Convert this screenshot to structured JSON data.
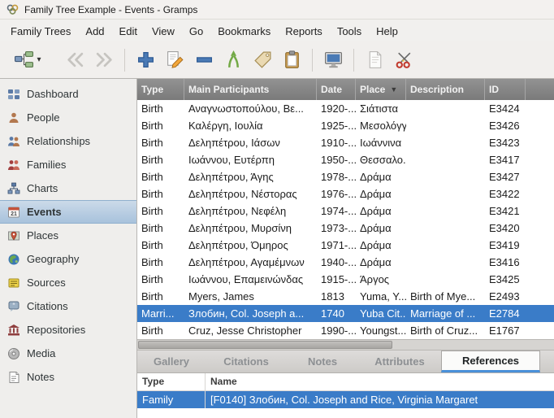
{
  "window": {
    "title": "Family Tree Example - Events - Gramps"
  },
  "menu": {
    "items": [
      "Family Trees",
      "Add",
      "Edit",
      "View",
      "Go",
      "Bookmarks",
      "Reports",
      "Tools",
      "Help"
    ]
  },
  "toolbar": {
    "buttons": [
      "family-trees-button",
      "back-button",
      "forward-button",
      "add-button",
      "edit-button",
      "remove-button",
      "merge-button",
      "tag-button",
      "clipboard-button",
      "configure-view-button",
      "report-button",
      "scissors-button"
    ]
  },
  "sidebar": {
    "items": [
      {
        "label": "Dashboard",
        "icon": "dashboard-icon",
        "selected": false
      },
      {
        "label": "People",
        "icon": "people-icon",
        "selected": false
      },
      {
        "label": "Relationships",
        "icon": "relationships-icon",
        "selected": false
      },
      {
        "label": "Families",
        "icon": "families-icon",
        "selected": false
      },
      {
        "label": "Charts",
        "icon": "charts-icon",
        "selected": false
      },
      {
        "label": "Events",
        "icon": "events-icon",
        "selected": true
      },
      {
        "label": "Places",
        "icon": "places-icon",
        "selected": false
      },
      {
        "label": "Geography",
        "icon": "geography-icon",
        "selected": false
      },
      {
        "label": "Sources",
        "icon": "sources-icon",
        "selected": false
      },
      {
        "label": "Citations",
        "icon": "citations-icon",
        "selected": false
      },
      {
        "label": "Repositories",
        "icon": "repositories-icon",
        "selected": false
      },
      {
        "label": "Media",
        "icon": "media-icon",
        "selected": false
      },
      {
        "label": "Notes",
        "icon": "notes-icon",
        "selected": false
      }
    ]
  },
  "main_table": {
    "columns": [
      "Type",
      "Main Participants",
      "Date",
      "Place",
      "Description",
      "ID"
    ],
    "sort_column": "Place",
    "sort_glyph": "▼",
    "selected_row_index": 12,
    "rows": [
      {
        "type": "Birth",
        "participants": "Αναγνωστοπούλου, Βε...",
        "date": "1920-...",
        "place": "Σιάτιστα",
        "description": "",
        "id": "E3424"
      },
      {
        "type": "Birth",
        "participants": "Καλέργη, Ιουλία",
        "date": "1925-...",
        "place": "Μεσολόγγι",
        "description": "",
        "id": "E3426"
      },
      {
        "type": "Birth",
        "participants": "Δεληπέτρου, Ιάσων",
        "date": "1910-...",
        "place": "Ιωάννινα",
        "description": "",
        "id": "E3423"
      },
      {
        "type": "Birth",
        "participants": "Ιωάννου, Ευτέρπη",
        "date": "1950-...",
        "place": "Θεσσαλο...",
        "description": "",
        "id": "E3417"
      },
      {
        "type": "Birth",
        "participants": "Δεληπέτρου, Άγης",
        "date": "1978-...",
        "place": "Δράμα",
        "description": "",
        "id": "E3427"
      },
      {
        "type": "Birth",
        "participants": "Δεληπέτρου, Νέστορας",
        "date": "1976-...",
        "place": "Δράμα",
        "description": "",
        "id": "E3422"
      },
      {
        "type": "Birth",
        "participants": "Δεληπέτρου, Νεφέλη",
        "date": "1974-...",
        "place": "Δράμα",
        "description": "",
        "id": "E3421"
      },
      {
        "type": "Birth",
        "participants": "Δεληπέτρου, Μυρσίνη",
        "date": "1973-...",
        "place": "Δράμα",
        "description": "",
        "id": "E3420"
      },
      {
        "type": "Birth",
        "participants": "Δεληπέτρου, Όμηρος",
        "date": "1971-...",
        "place": "Δράμα",
        "description": "",
        "id": "E3419"
      },
      {
        "type": "Birth",
        "participants": "Δεληπέτρου, Αγαμέμνων",
        "date": "1940-...",
        "place": "Δράμα",
        "description": "",
        "id": "E3416"
      },
      {
        "type": "Birth",
        "participants": "Ιωάννου, Επαμεινώνδας",
        "date": "1915-...",
        "place": "Άργος",
        "description": "",
        "id": "E3425"
      },
      {
        "type": "Birth",
        "participants": "Myers, James",
        "date": "1813",
        "place": "Yuma, Y...",
        "description": "Birth of Mye...",
        "id": "E2493"
      },
      {
        "type": "Marri...",
        "participants": "Злобин, Col. Joseph a...",
        "date": "1740",
        "place": "Yuba Cit...",
        "description": "Marriage of ...",
        "id": "E2784"
      },
      {
        "type": "Birth",
        "participants": "Cruz, Jesse Christopher",
        "date": "1990-...",
        "place": "Youngst...",
        "description": "Birth of Cruz...",
        "id": "E1767"
      }
    ]
  },
  "tabs": {
    "items": [
      "Gallery",
      "Citations",
      "Notes",
      "Attributes",
      "References"
    ],
    "active": "References"
  },
  "references_table": {
    "columns": [
      "Type",
      "Name"
    ],
    "selected_row_index": 0,
    "rows": [
      {
        "type": "Family",
        "name": "[F0140] Злобин, Col. Joseph and Rice, Virginia Margaret"
      }
    ]
  },
  "colors": {
    "selection_blue": "#3a7cc8",
    "tab_accent": "#4a90d9",
    "header_gray": "#7f7f7f"
  }
}
